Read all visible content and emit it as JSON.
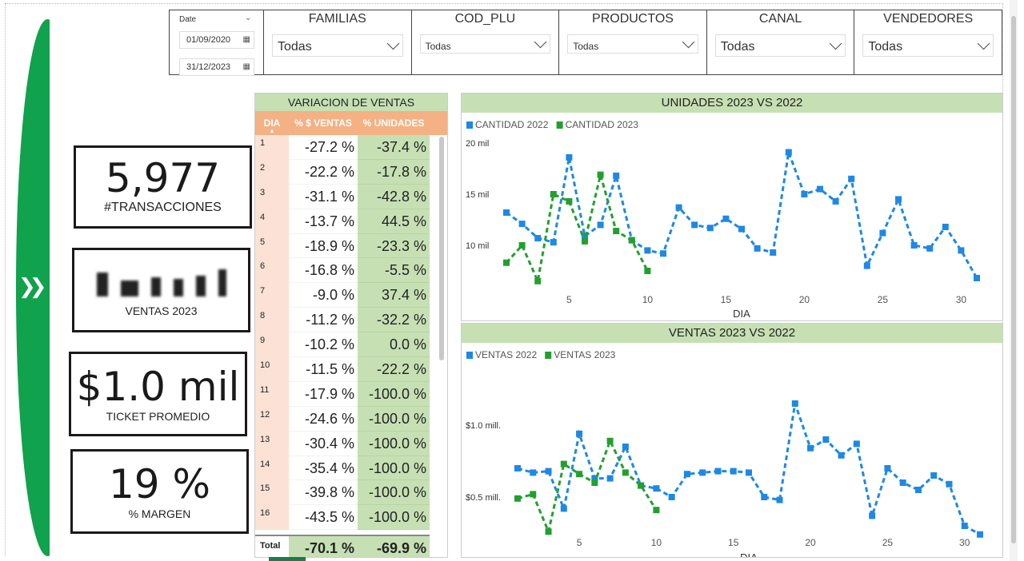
{
  "filters": {
    "date": {
      "label": "Date",
      "start": "01/09/2020",
      "end": "31/12/2023"
    },
    "slicers": [
      {
        "title": "FAMILIAS",
        "value": "Todas",
        "small": false
      },
      {
        "title": "COD_PLU",
        "value": "Todas",
        "small": true
      },
      {
        "title": "PRODUCTOS",
        "value": "Todas",
        "small": true
      },
      {
        "title": "CANAL",
        "value": "Todas",
        "small": false
      },
      {
        "title": "VENDEDORES",
        "value": "Todas",
        "small": false
      }
    ]
  },
  "kpis": {
    "transacciones": {
      "value": "5,977",
      "label": "#TRANSACCIONES"
    },
    "ventas": {
      "label": "VENTAS 2023"
    },
    "ticket": {
      "value": "$1.0 mil",
      "label": "TICKET PROMEDIO"
    },
    "margen": {
      "value": "19 %",
      "label": "% MARGEN"
    }
  },
  "table": {
    "title": "VARIACION DE VENTAS",
    "headers": {
      "dia": "DIA",
      "ventas": "% $ VENTAS",
      "unidades": "% UNIDADES"
    },
    "rows": [
      {
        "dia": "1",
        "ventas": "-27.2 %",
        "unidades": "-37.4 %"
      },
      {
        "dia": "2",
        "ventas": "-22.2 %",
        "unidades": "-17.8 %"
      },
      {
        "dia": "3",
        "ventas": "-31.1 %",
        "unidades": "-42.8 %"
      },
      {
        "dia": "4",
        "ventas": "-13.7 %",
        "unidades": "44.5 %"
      },
      {
        "dia": "5",
        "ventas": "-18.9 %",
        "unidades": "-23.3 %"
      },
      {
        "dia": "6",
        "ventas": "-16.8 %",
        "unidades": "-5.5 %"
      },
      {
        "dia": "7",
        "ventas": "-9.0 %",
        "unidades": "37.4 %"
      },
      {
        "dia": "8",
        "ventas": "-11.2 %",
        "unidades": "-32.2 %"
      },
      {
        "dia": "9",
        "ventas": "-10.2 %",
        "unidades": "0.0 %"
      },
      {
        "dia": "10",
        "ventas": "-11.5 %",
        "unidades": "-22.2 %"
      },
      {
        "dia": "11",
        "ventas": "-17.9 %",
        "unidades": "-100.0 %"
      },
      {
        "dia": "12",
        "ventas": "-24.6 %",
        "unidades": "-100.0 %"
      },
      {
        "dia": "13",
        "ventas": "-30.4 %",
        "unidades": "-100.0 %"
      },
      {
        "dia": "14",
        "ventas": "-35.4 %",
        "unidades": "-100.0 %"
      },
      {
        "dia": "15",
        "ventas": "-39.8 %",
        "unidades": "-100.0 %"
      },
      {
        "dia": "16",
        "ventas": "-43.5 %",
        "unidades": "-100.0 %"
      }
    ],
    "total": {
      "label": "Total",
      "ventas": "-70.1 %",
      "unidades": "-69.9 %"
    }
  },
  "colors": {
    "green_accent": "#10a24c",
    "header_orange": "#f4b183",
    "light_green": "#c6e0b4",
    "series_2022": "#1e88e5",
    "series_2023": "#22a02f"
  },
  "chart_data": [
    {
      "type": "line",
      "title": "UNIDADES 2023 VS 2022",
      "xlabel": "DIA",
      "ylabel": "",
      "xlim": [
        1,
        31
      ],
      "ylim": [
        5,
        20
      ],
      "xticks": [
        5,
        10,
        15,
        20,
        25,
        30
      ],
      "yticks": [
        {
          "value": 10,
          "label": "10 mil"
        },
        {
          "value": 15,
          "label": "15 mil"
        },
        {
          "value": 20,
          "label": "20 mil"
        }
      ],
      "legend": "top-left",
      "series": [
        {
          "name": "CANTIDAD 2022",
          "color": "#1e88e5",
          "x": [
            1,
            2,
            3,
            4,
            5,
            6,
            7,
            8,
            9,
            10,
            11,
            12,
            13,
            14,
            15,
            16,
            17,
            18,
            19,
            20,
            21,
            22,
            23,
            24,
            25,
            26,
            27,
            28,
            29,
            30,
            31
          ],
          "values": [
            13.2,
            12.1,
            10.7,
            10.3,
            18.6,
            10.9,
            12.0,
            16.8,
            10.5,
            9.5,
            9.2,
            13.7,
            12.0,
            11.7,
            12.6,
            11.6,
            9.7,
            9.3,
            19.1,
            15.0,
            15.5,
            14.3,
            16.5,
            8.0,
            11.2,
            14.5,
            10.0,
            9.7,
            11.8,
            9.5,
            6.8
          ]
        },
        {
          "name": "CANTIDAD 2023",
          "color": "#22a02f",
          "x": [
            1,
            2,
            3,
            4,
            5,
            6,
            7,
            8,
            9,
            10
          ],
          "values": [
            8.3,
            10.0,
            6.5,
            15.0,
            14.3,
            10.4,
            16.9,
            11.4,
            10.5,
            7.5
          ]
        }
      ]
    },
    {
      "type": "line",
      "title": "VENTAS 2023 VS 2022",
      "xlabel": "DIA",
      "ylabel": "",
      "xlim": [
        1,
        31
      ],
      "ylim": [
        0.3,
        1.4
      ],
      "xticks": [
        5,
        10,
        15,
        20,
        25,
        30
      ],
      "yticks": [
        {
          "value": 0.5,
          "label": "$0.5 mill."
        },
        {
          "value": 1.0,
          "label": "$1.0 mill."
        }
      ],
      "legend": "top-left",
      "series": [
        {
          "name": "VENTAS 2022",
          "color": "#1e88e5",
          "x": [
            1,
            2,
            3,
            4,
            5,
            6,
            7,
            8,
            9,
            10,
            11,
            12,
            13,
            14,
            15,
            16,
            17,
            18,
            19,
            20,
            21,
            22,
            23,
            24,
            25,
            26,
            27,
            28,
            29,
            30,
            31
          ],
          "values": [
            0.7,
            0.67,
            0.68,
            0.42,
            0.94,
            0.63,
            0.63,
            0.85,
            0.58,
            0.56,
            0.5,
            0.66,
            0.67,
            0.68,
            0.68,
            0.67,
            0.5,
            0.48,
            1.15,
            0.84,
            0.9,
            0.79,
            0.87,
            0.37,
            0.7,
            0.6,
            0.55,
            0.65,
            0.59,
            0.3,
            0.24
          ]
        },
        {
          "name": "VENTAS 2023",
          "color": "#22a02f",
          "x": [
            1,
            2,
            3,
            4,
            5,
            6,
            7,
            8,
            9,
            10
          ],
          "values": [
            0.49,
            0.52,
            0.26,
            0.73,
            0.66,
            0.6,
            0.89,
            0.67,
            0.58,
            0.41
          ]
        }
      ]
    }
  ]
}
